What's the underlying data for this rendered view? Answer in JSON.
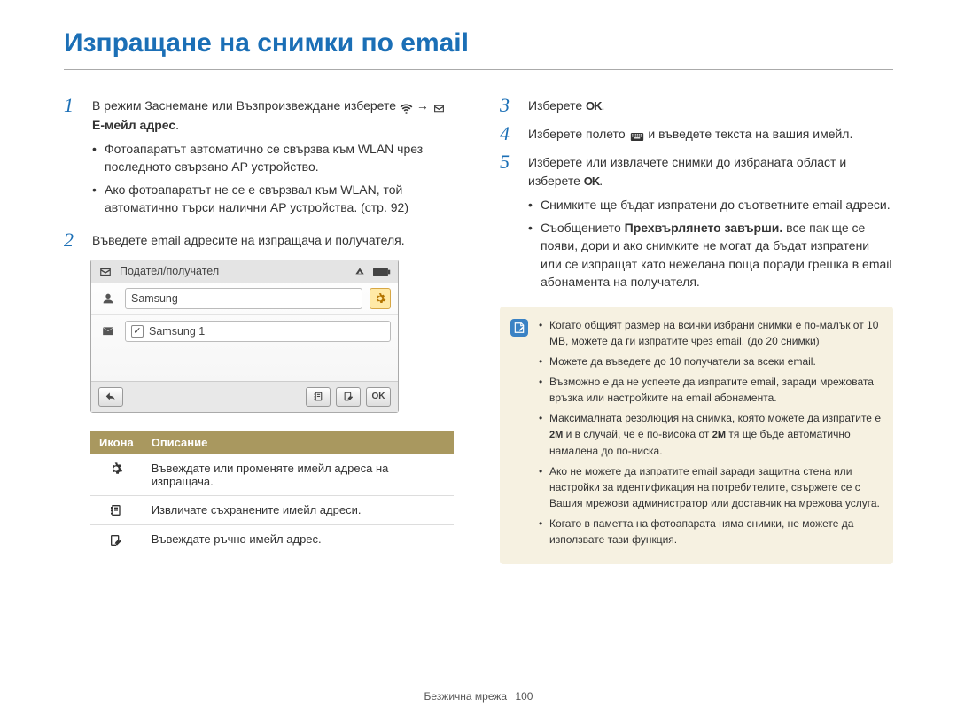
{
  "title": "Изпращане на снимки по email",
  "left": {
    "step1": {
      "text_a": "В режим Заснемане или Възпроизвеждане изберете ",
      "text_b": " → ",
      "text_c": " Е-мейл адрес",
      "text_d": ".",
      "bullet1": "Фотоапаратът автоматично се свързва към WLAN чрез последното свързано AP устройство.",
      "bullet2": "Ако фотоапаратът не се е свързвал към WLAN, той автоматично търси налични AP устройства. (стр. 92)"
    },
    "step2": "Въведете email адресите на изпращача и получателя.",
    "shot": {
      "header": "Подател/получател",
      "row1": "Samsung",
      "row2": "Samsung 1"
    },
    "icon_table": {
      "head_icon": "Икона",
      "head_desc": "Описание",
      "r1": "Въвеждате или променяте имейл адреса на изпращача.",
      "r2": "Извличате съхранените имейл адреси.",
      "r3": "Въвеждате ръчно имейл адрес."
    }
  },
  "right": {
    "step3_a": "Изберете ",
    "step3_b": ".",
    "step4_a": "Изберете полето ",
    "step4_b": " и въведете текста на вашия имейл.",
    "step5_a": "Изберете или извлачете снимки до избраната област и изберете ",
    "step5_b": ".",
    "step5_bullets": {
      "b1": "Снимките ще бъдат изпратени до съответните email адреси.",
      "b2_a": "Съобщението ",
      "b2_bold": "Прехвърлянето завърши.",
      "b2_b": " все пак ще се появи, дори и ако снимките не могат да бъдат изпратени или се изпращат като нежелана поща поради грешка в email абонамента на получателя."
    },
    "notes": {
      "n1": "Когато общият размер на всички избрани снимки е по-малък от 10 MB, можете да ги изпратите чрез email. (до 20 снимки)",
      "n2": "Можете да въведете до 10 получатели за всеки email.",
      "n3": "Възможно е да не успеете да изпратите email, заради мрежовата връзка или настройките на email абонамента.",
      "n4_a": "Максималната резолюция на снимка, която можете да изпратите е ",
      "n4_b": " и в случай, че е по-висока от ",
      "n4_c": " тя ще бъде автоматично намалена до по-ниска.",
      "n5": "Ако не можете да изпратите email заради защитна стена или настройки за идентификация на потребителите, свържете се с Вашия мрежови администратор или доставчик на мрежова услуга.",
      "n6": "Когато в паметта на фотоапарата няма снимки, не можете да използвате тази функция."
    }
  },
  "icons": {
    "wifi": "wifi-icon",
    "envelope": "envelope-icon",
    "ok": "OK",
    "keyboard": "keyboard-icon",
    "gear": "gear-icon",
    "person": "person-icon",
    "addressbook": "address-book-icon",
    "edit": "edit-icon",
    "back": "back-icon",
    "signal": "signal-icon",
    "battery": "battery-icon",
    "twom": "2M"
  },
  "footer": {
    "section": "Безжична мрежа",
    "page": "100"
  }
}
